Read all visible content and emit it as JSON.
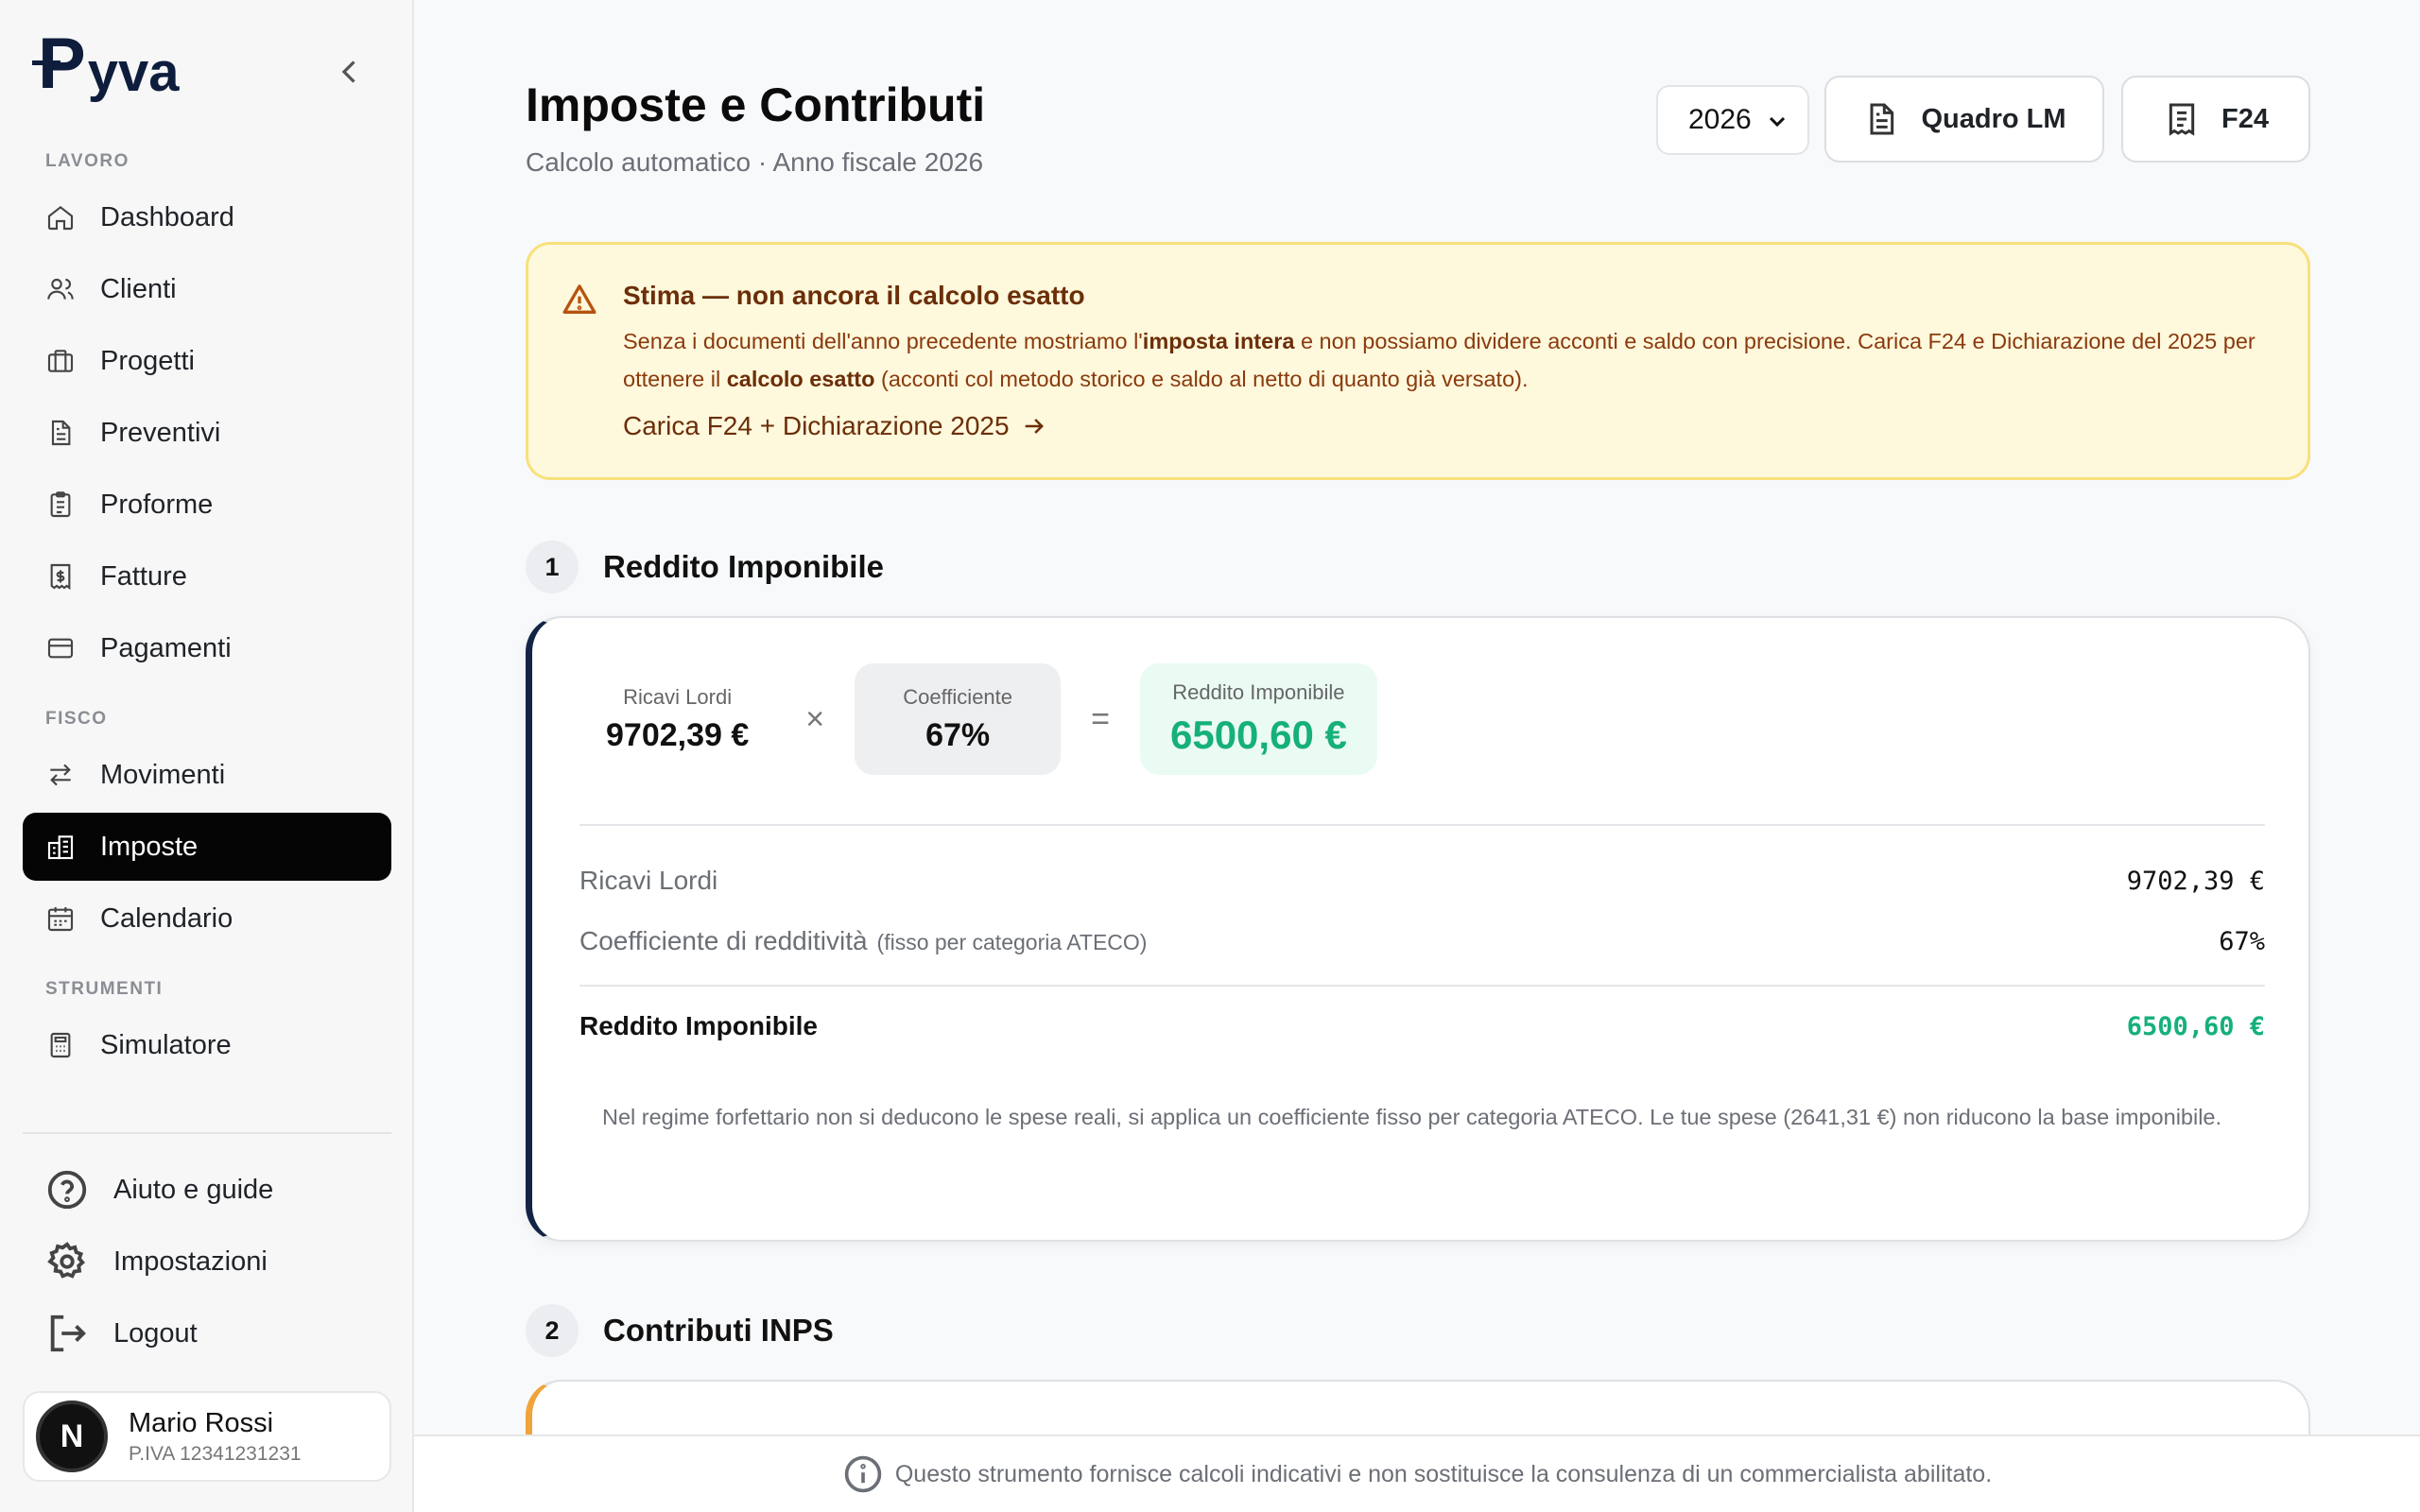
{
  "brand": {
    "logo_p": "P",
    "logo_rest": "yva"
  },
  "sidebar": {
    "sections": [
      "LAVORO",
      "FISCO",
      "STRUMENTI"
    ],
    "items": [
      {
        "label": "Dashboard",
        "icon": "home-icon"
      },
      {
        "label": "Clienti",
        "icon": "users-icon"
      },
      {
        "label": "Progetti",
        "icon": "briefcase-icon"
      },
      {
        "label": "Preventivi",
        "icon": "document-icon"
      },
      {
        "label": "Proforme",
        "icon": "clipboard-icon"
      },
      {
        "label": "Fatture",
        "icon": "invoice-icon"
      },
      {
        "label": "Pagamenti",
        "icon": "card-icon"
      },
      {
        "label": "Movimenti",
        "icon": "arrows-icon"
      },
      {
        "label": "Imposte",
        "icon": "building-icon",
        "active": true
      },
      {
        "label": "Calendario",
        "icon": "calendar-icon"
      },
      {
        "label": "Simulatore",
        "icon": "calculator-icon"
      }
    ],
    "bottom": [
      {
        "label": "Aiuto e guide",
        "icon": "help-icon"
      },
      {
        "label": "Impostazioni",
        "icon": "gear-icon"
      },
      {
        "label": "Logout",
        "icon": "logout-icon"
      }
    ],
    "user": {
      "initial": "N",
      "name": "Mario Rossi",
      "piva": "P.IVA 12341231231"
    }
  },
  "header": {
    "title": "Imposte e Contributi",
    "subtitle": "Calcolo automatico · Anno fiscale 2026",
    "year": "2026",
    "btn_quadro": "Quadro LM",
    "btn_f24": "F24"
  },
  "alert": {
    "title": "Stima — non ancora il calcolo esatto",
    "body_1": "Senza i documenti dell'anno precedente mostriamo l'",
    "bold_1": "imposta intera",
    "body_2": " e non possiamo dividere acconti e saldo con precisione. Carica F24 e Dichiarazione del 2025 per ottenere il ",
    "bold_2": "calcolo esatto",
    "body_3": " (acconti col metodo storico e saldo al netto di quanto già versato).",
    "link": "Carica F24 + Dichiarazione 2025"
  },
  "step1": {
    "num": "1",
    "title": "Reddito Imponibile",
    "f_ricavi_label": "Ricavi Lordi",
    "f_ricavi_val": "9702,39 €",
    "f_coef_label": "Coefficiente",
    "f_coef_val": "67%",
    "f_res_label": "Reddito Imponibile",
    "f_res_val": "6500,60 €",
    "op_mul": "×",
    "op_eq": "=",
    "row1_label": "Ricavi Lordi",
    "row1_val": "9702,39 €",
    "row2_label": "Coefficiente di redditività",
    "row2_hint": "(fisso per categoria ATECO)",
    "row2_val": "67%",
    "row3_label": "Reddito Imponibile",
    "row3_val": "6500,60 €",
    "note": "Nel regime forfettario non si deducono le spese reali, si applica un coefficiente fisso per categoria ATECO. Le tue spese (2641,31 €) non riducono la base imponibile."
  },
  "step2": {
    "num": "2",
    "title": "Contributi INPS"
  },
  "footer": {
    "text": "Questo strumento fornisce calcoli indicativi e non sostituisce la consulenza di un commercialista abilitato."
  },
  "colors": {
    "accent_green": "#16b07a",
    "navy": "#0f1d3d",
    "alert_bg": "#fef8dc",
    "alert_text": "#6b2e08",
    "inps_accent": "#f0a33a"
  }
}
